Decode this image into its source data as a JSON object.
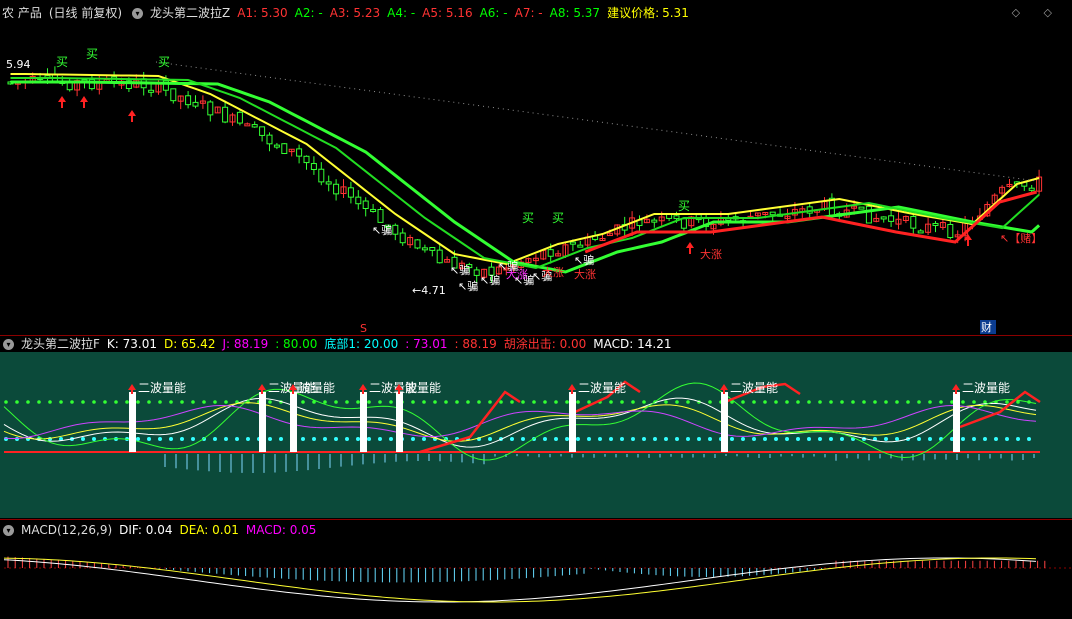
{
  "main": {
    "stock_name": "农 产品",
    "period": "(日线 前复权)",
    "indicator": "龙头第二波拉Z",
    "params": [
      {
        "label": "A1:",
        "value": "5.30",
        "color": "#ff3333"
      },
      {
        "label": "A2:",
        "value": "-",
        "color": "#00ff00"
      },
      {
        "label": "A3:",
        "value": "5.23",
        "color": "#ff3333"
      },
      {
        "label": "A4:",
        "value": "-",
        "color": "#00ff00"
      },
      {
        "label": "A5:",
        "value": "5.16",
        "color": "#ff3333"
      },
      {
        "label": "A6:",
        "value": "-",
        "color": "#00ff00"
      },
      {
        "label": "A7:",
        "value": "-",
        "color": "#ff3333"
      },
      {
        "label": "A8:",
        "value": "5.37",
        "color": "#00ff00"
      }
    ],
    "advice_label": "建议价格:",
    "advice_value": "5.31",
    "high_price": "5.94",
    "low_price": "4.71",
    "buy_label": "买",
    "deceive_label": "骗",
    "big_rise_label": "大涨",
    "gamble_label": "【赌】",
    "marker_s": "S",
    "marker_cai": "财"
  },
  "kdj": {
    "indicator": "龙头第二波拉F",
    "params": [
      {
        "label": "K:",
        "value": "73.01",
        "color": "#ffffff"
      },
      {
        "label": "D:",
        "value": "65.42",
        "color": "#ffff00"
      },
      {
        "label": "J:",
        "value": "88.19",
        "color": "#ff00ff"
      },
      {
        "label": ":",
        "value": "80.00",
        "color": "#00ff00"
      },
      {
        "label": "底部1:",
        "value": "20.00",
        "color": "#00ffff"
      },
      {
        "label": ":",
        "value": "73.01",
        "color": "#ff00ff"
      },
      {
        "label": ":",
        "value": "88.19",
        "color": "#ff3333"
      },
      {
        "label": "胡涂出击:",
        "value": "0.00",
        "color": "#ff3333"
      },
      {
        "label": "MACD:",
        "value": "14.21",
        "color": "#ffffff"
      }
    ],
    "wave_label": "二波量能"
  },
  "macd": {
    "indicator": "MACD(12,26,9)",
    "params": [
      {
        "label": "DIF:",
        "value": "0.04",
        "color": "#ffffff"
      },
      {
        "label": "DEA:",
        "value": "0.01",
        "color": "#ffff00"
      },
      {
        "label": "MACD:",
        "value": "0.05",
        "color": "#ff00ff"
      }
    ]
  },
  "right_icons": "◇ ◇"
}
